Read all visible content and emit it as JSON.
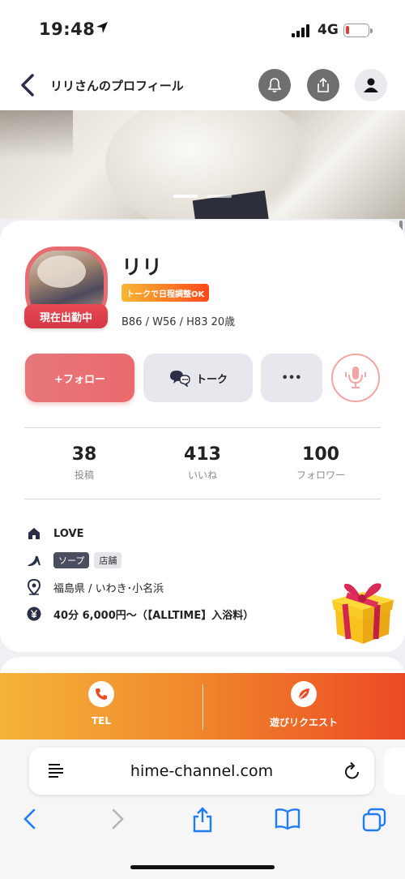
{
  "status_bar": {
    "time": "19:48",
    "network": "4G",
    "battery_level": 0.15
  },
  "header": {
    "title": "リリさんのプロフィール"
  },
  "hero": {
    "active_slide": 1,
    "slide_count": 2
  },
  "profile": {
    "name": "リリ",
    "live_badge": "現在出勤中",
    "talk_tag": "トークで日程調整OK",
    "measurements": "B86 / W56 / H83  20歳"
  },
  "actions": {
    "follow": "+フォロー",
    "talk": "トーク",
    "more": "•••"
  },
  "stats": [
    {
      "value": "38",
      "label": "投稿"
    },
    {
      "value": "413",
      "label": "いいね"
    },
    {
      "value": "100",
      "label": "フォロワー"
    }
  ],
  "info": {
    "shop": "LOVE",
    "categories": [
      "ソープ",
      "店舗"
    ],
    "location": "福島県 / いわき･小名浜",
    "price": "40分 6,000円〜（【ALLTIME】入浴料）"
  },
  "cta": {
    "tel": "TEL",
    "request": "遊びリクエスト"
  },
  "browser": {
    "url": "hime-channel.com"
  },
  "colors": {
    "accent": "#ec6a6d",
    "live": "#d23843",
    "cta_start": "#f5b43a",
    "cta_end": "#ec4a25",
    "ios_blue": "#1f7cf4"
  }
}
